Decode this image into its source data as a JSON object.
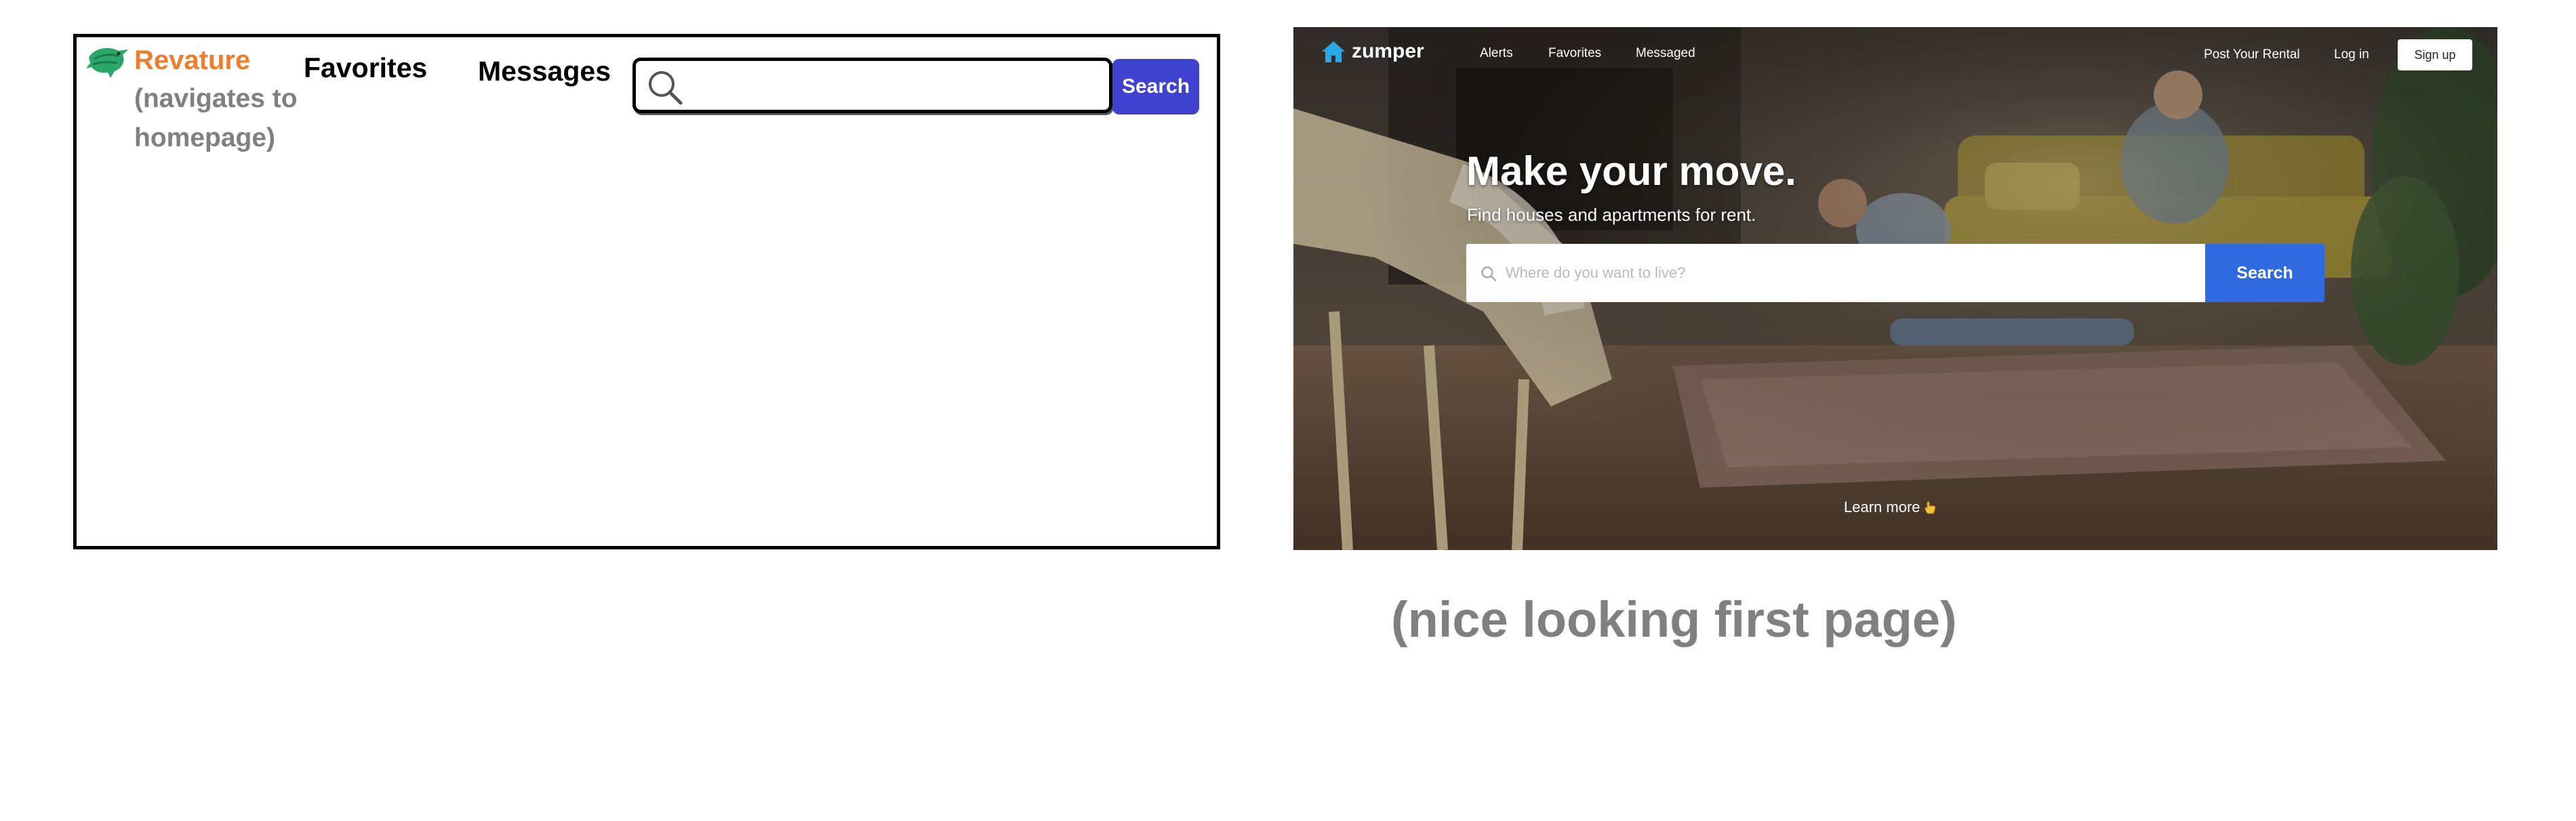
{
  "wireframe": {
    "brand": "Revature",
    "brand_note": "(navigates to homepage)",
    "nav": {
      "favorites": "Favorites",
      "messages": "Messages"
    },
    "search": {
      "value": "",
      "button_label": "Search"
    },
    "colors": {
      "brand": "#ef7d2c",
      "note": "#808080",
      "search_button": "#3f43d0"
    },
    "icons": {
      "logo": "revature-bird-logo-icon",
      "search": "magnifier-icon"
    }
  },
  "zumper": {
    "logo_text": "zumper",
    "nav": {
      "alerts": "Alerts",
      "favorites": "Favorites",
      "messaged": "Messaged",
      "post_rental": "Post Your Rental",
      "login": "Log in",
      "signup": "Sign up"
    },
    "hero": {
      "headline": "Make your move.",
      "subheadline": "Find houses and apartments for rent."
    },
    "search": {
      "placeholder": "Where do you want to live?",
      "button_label": "Search"
    },
    "learn_more": "Learn more",
    "colors": {
      "logo_house": "#29a8e6",
      "search_button": "#2f6ae0"
    },
    "icons": {
      "logo": "house-icon",
      "search": "search-icon",
      "learn_more": "pointing-hand-icon"
    }
  },
  "caption": "(nice looking first page)"
}
